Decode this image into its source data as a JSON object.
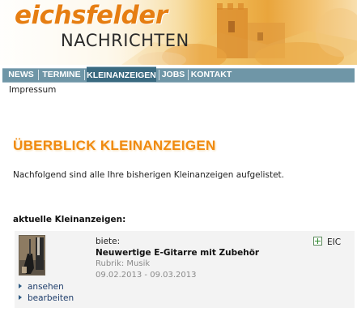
{
  "brand": {
    "name_top": "eichsfelder",
    "name_bottom": "NACHRICHTEN"
  },
  "nav": {
    "items": [
      {
        "label": "NEWS",
        "active": false
      },
      {
        "label": "TERMINE",
        "active": false
      },
      {
        "label": "KLEINANZEIGEN",
        "active": true
      },
      {
        "label": "JOBS",
        "active": false
      },
      {
        "label": "KONTAKT",
        "active": false
      }
    ],
    "subnav": {
      "impressum": "Impressum"
    }
  },
  "main": {
    "title": "ÜBERBLICK KLEINANZEIGEN",
    "intro": "Nachfolgend sind alle Ihre bisherigen Kleinanzeigen aufgelistet.",
    "section_heading": "aktuelle Kleinanzeigen:"
  },
  "ads": [
    {
      "label": "biete:",
      "title": "Neuwertige E-Gitarre mit Zubehör",
      "category": "Rubrik: Musik",
      "date_range": "09.02.2013 - 09.03.2013",
      "region": "EIC",
      "actions": {
        "view": "ansehen",
        "edit": "bearbeiten"
      },
      "thumbnail_icon": "guitar-photo"
    }
  ],
  "colors": {
    "brand_orange": "#e67e12",
    "title_orange": "#f08a10",
    "nav_blue": "#6f96a7",
    "nav_active": "#3a6a80",
    "link_blue": "#1e3d6b",
    "ad_background": "#f3f3f3"
  }
}
